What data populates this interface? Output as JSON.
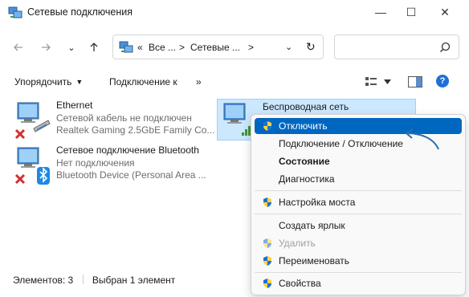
{
  "window": {
    "title": "Сетевые подключения",
    "minimize_glyph": "—",
    "maximize_glyph": "☐",
    "close_glyph": "✕"
  },
  "address": {
    "overflow": "«",
    "crumbs": [
      "Все ...",
      "Сетевые ..."
    ],
    "separators": [
      ">",
      ">"
    ],
    "dropdown_glyph": "⌄",
    "refresh_glyph": "↻"
  },
  "search": {
    "placeholder": "",
    "icon": "search-icon"
  },
  "commands": {
    "organize": "Упорядочить",
    "connect_to": "Подключение к",
    "more": "»",
    "help": "?"
  },
  "connections": [
    {
      "name": "Ethernet",
      "status": "Сетевой кабель не подключен",
      "device": "Realtek Gaming 2.5GbE Family Co..."
    },
    {
      "name": "Беспроводная сеть",
      "status": "",
      "device": ""
    },
    {
      "name": "Сетевое подключение Bluetooth",
      "status": "Нет подключения",
      "device": "Bluetooth Device (Personal Area ..."
    }
  ],
  "status": {
    "items": "Элементов: 3",
    "selected": "Выбран 1 элемент"
  },
  "context_menu": {
    "items": [
      {
        "label": "Отключить",
        "shield": true,
        "highlighted": true
      },
      {
        "label": "Подключение / Отключение",
        "shield": false
      },
      {
        "label": "Состояние",
        "shield": false,
        "bold": true
      },
      {
        "label": "Диагностика",
        "shield": false
      },
      {
        "label": "Настройка моста",
        "shield": true
      },
      {
        "label": "Создать ярлык",
        "shield": false
      },
      {
        "label": "Удалить",
        "shield": true,
        "disabled": true
      },
      {
        "label": "Переименовать",
        "shield": true
      },
      {
        "label": "Свойства",
        "shield": true
      }
    ]
  },
  "colors": {
    "accent": "#0067c0",
    "selection": "#cce8ff",
    "arrow": "#2b6cb0",
    "error_red": "#d32f2f",
    "bluetooth": "#1e88e5"
  }
}
